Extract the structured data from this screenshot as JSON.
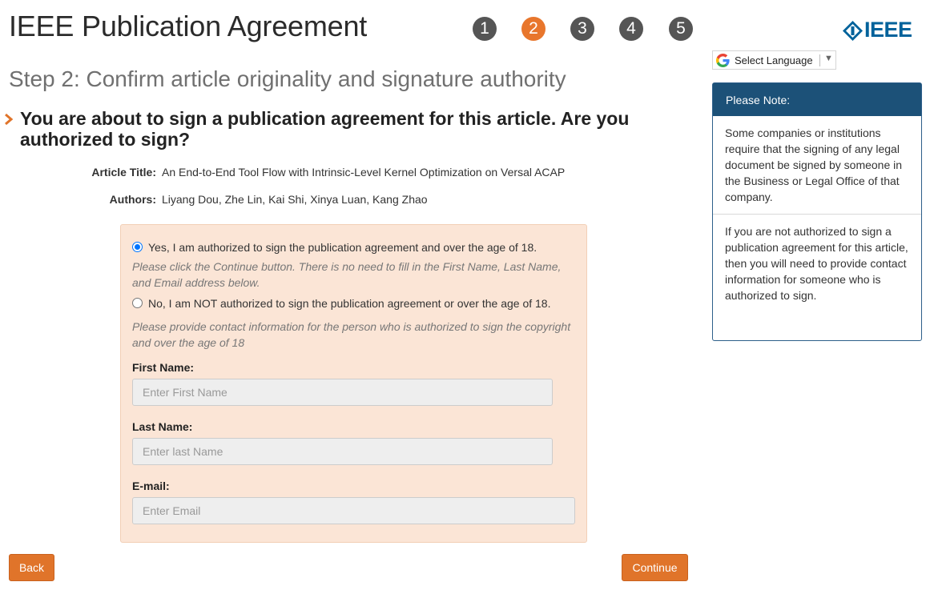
{
  "app": {
    "title": "IEEE Publication Agreement"
  },
  "stepper": {
    "steps": [
      "1",
      "2",
      "3",
      "4",
      "5"
    ],
    "active_step": "2",
    "active_color": "#e8762c",
    "inactive_color": "#555555"
  },
  "logo": {
    "text": "IEEE",
    "icon": "ieee-diamond-icon",
    "color": "#00629b"
  },
  "language": {
    "label": "Select Language",
    "arrow": "▼",
    "icon": "google-g-icon"
  },
  "step_heading": "Step 2: Confirm article originality and signature authority",
  "question": "You are about to sign a publication agreement for this article. Are you authorized to sign?",
  "article": {
    "title_label": "Article Title:",
    "title": "An End-to-End Tool Flow with Intrinsic-Level Kernel Optimization on Versal ACAP",
    "authors_label": "Authors:",
    "authors": "Liyang Dou, Zhe Lin, Kai Shi, Xinya Luan, Kang Zhao"
  },
  "form": {
    "option_yes": "Yes, I am authorized to sign the publication agreement and over the age of 18.",
    "option_yes_selected": true,
    "hint_yes": "Please click the Continue button. There is no need to fill in the First Name, Last Name, and Email address below.",
    "option_no": "No, I am NOT authorized to sign the publication agreement or over the age of 18.",
    "hint_no": "Please provide contact information for the person who is authorized to sign the copyright and over the age of 18",
    "first_name_label": "First Name:",
    "first_name_placeholder": "Enter First Name",
    "first_name_value": "",
    "last_name_label": "Last Name:",
    "last_name_placeholder": "Enter last Name",
    "last_name_value": "",
    "email_label": "E-mail:",
    "email_placeholder": "Enter Email",
    "email_value": ""
  },
  "buttons": {
    "back": "Back",
    "continue": "Continue",
    "color": "#e0742a"
  },
  "note": {
    "header": "Please Note:",
    "paragraph1": "Some companies or institutions require that the signing of any legal document be signed by someone in the Business or Legal Office of that company.",
    "paragraph2": "If you are not authorized to sign a publication agreement for this article, then you will need to provide contact information for someone who is authorized to sign.",
    "header_color": "#1c5178"
  }
}
